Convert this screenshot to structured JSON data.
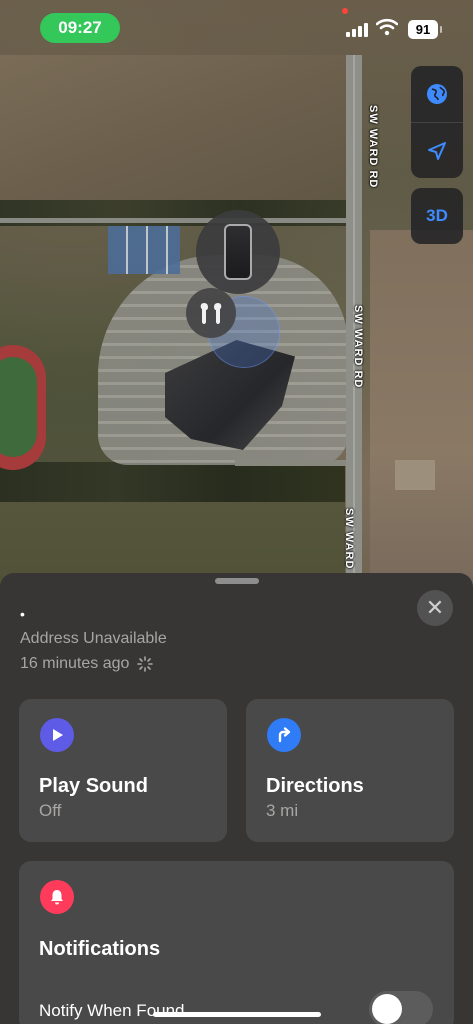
{
  "status_bar": {
    "time": "09:27",
    "battery": "91"
  },
  "map": {
    "road_labels": [
      "SW WARD RD",
      "SW WARD RD",
      "SW WARD"
    ],
    "controls": {
      "globe_icon": "globe-icon",
      "location_icon": "location-arrow-icon",
      "mode_3d": "3D"
    },
    "accent": "#3d8bff"
  },
  "sheet": {
    "item_name": "•",
    "address": "Address Unavailable",
    "updated": "16 minutes ago",
    "cards": {
      "play_sound": {
        "title": "Play Sound",
        "subtitle": "Off",
        "icon": "play-icon",
        "color": "#5e5ce6"
      },
      "directions": {
        "title": "Directions",
        "subtitle": "3 mi",
        "icon": "turn-right-arrow-icon",
        "color": "#2f7cf6"
      }
    },
    "notifications": {
      "title": "Notifications",
      "icon": "bell-icon",
      "color": "#ff3b5c",
      "notify_when_found": "Notify When Found",
      "notify_when_found_on": false
    }
  }
}
